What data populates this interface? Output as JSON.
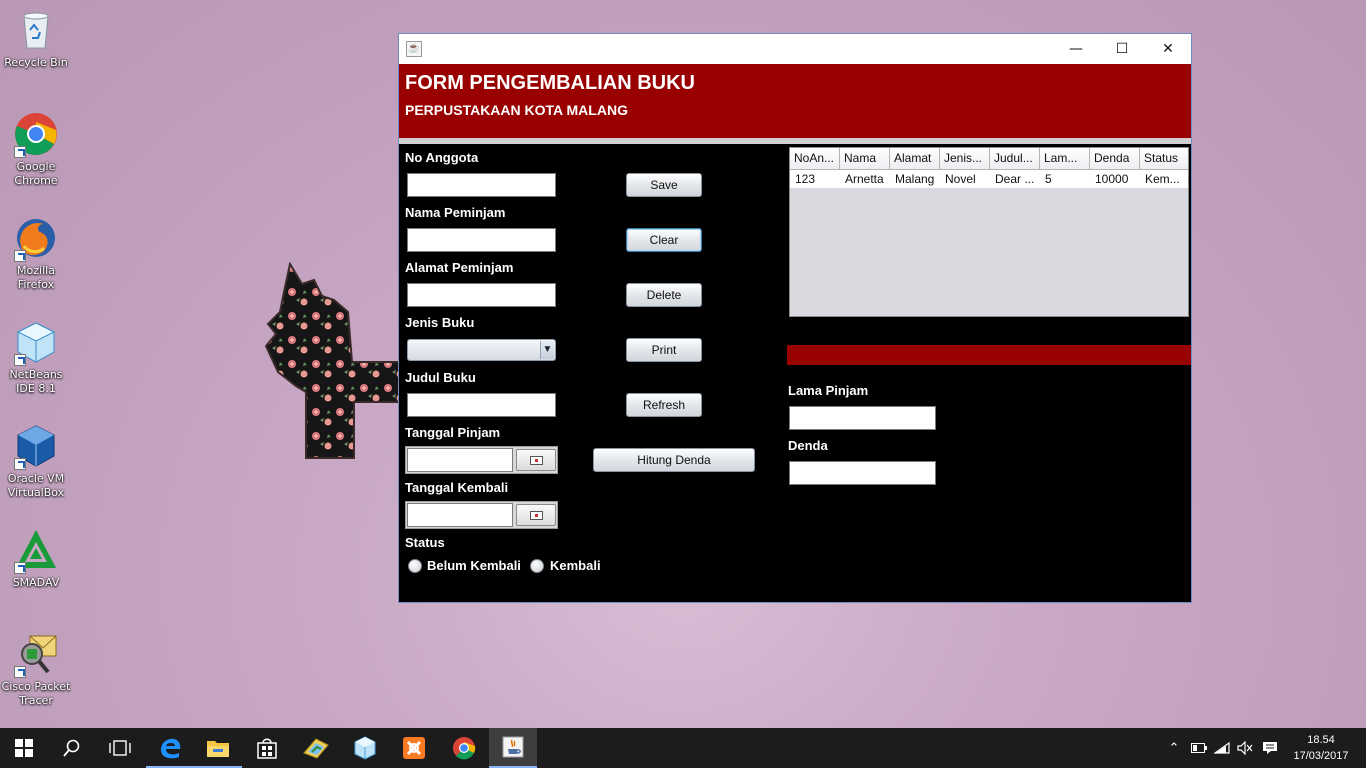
{
  "desktop": {
    "icons": [
      {
        "label": "Recycle Bin",
        "icon": "recycle-bin-icon"
      },
      {
        "label": "Google Chrome",
        "icon": "chrome-icon"
      },
      {
        "label": "Mozilla Firefox",
        "icon": "firefox-icon"
      },
      {
        "label": "NetBeans IDE 8.1",
        "icon": "netbeans-icon"
      },
      {
        "label": "Oracle VM VirtualBox",
        "icon": "virtualbox-icon"
      },
      {
        "label": "SMADAV",
        "icon": "smadav-icon"
      },
      {
        "label": "Cisco Packet Tracer",
        "icon": "packet-tracer-icon"
      }
    ]
  },
  "window": {
    "controls": {
      "minimize": "—",
      "maximize": "☐",
      "close": "✕"
    }
  },
  "form": {
    "title": "FORM PENGEMBALIAN BUKU",
    "subtitle": "PERPUSTAKAAN KOTA MALANG",
    "labels": {
      "no_anggota": "No Anggota",
      "nama_peminjam": "Nama Peminjam",
      "alamat_peminjam": "Alamat Peminjam",
      "jenis_buku": "Jenis Buku",
      "judul_buku": "Judul Buku",
      "tanggal_pinjam": "Tanggal Pinjam",
      "tanggal_kembali": "Tanggal Kembali",
      "status": "Status",
      "lama_pinjam": "Lama Pinjam",
      "denda": "Denda"
    },
    "values": {
      "no_anggota": "",
      "nama_peminjam": "",
      "alamat_peminjam": "",
      "jenis_buku": "",
      "judul_buku": "",
      "tanggal_pinjam": "",
      "tanggal_kembali": "",
      "lama_pinjam": "",
      "denda": ""
    },
    "buttons": {
      "save": "Save",
      "clear": "Clear",
      "delete": "Delete",
      "print": "Print",
      "refresh": "Refresh",
      "hitung_denda": "Hitung Denda"
    },
    "status_options": {
      "belum_kembali": "Belum Kembali",
      "kembali": "Kembali"
    }
  },
  "table": {
    "columns": [
      "NoAn...",
      "Nama",
      "Alamat",
      "Jenis...",
      "Judul...",
      "Lam...",
      "Denda",
      "Status"
    ],
    "rows": [
      [
        "123",
        "Arnetta",
        "Malang",
        "Novel",
        "Dear ...",
        "5",
        "10000",
        "Kem..."
      ]
    ]
  },
  "taskbar": {
    "apps": [
      "start-icon",
      "search-icon",
      "task-view-icon",
      "edge-icon",
      "file-explorer-icon",
      "store-icon",
      "file-manager-icon",
      "netbeans-icon",
      "xampp-icon",
      "chrome-icon",
      "java-icon"
    ],
    "clock_time": "18.54",
    "clock_date": "17/03/2017"
  },
  "colors": {
    "header_red": "#990000",
    "window_bg": "#000000",
    "desktop_bg": "#c4a6c0"
  }
}
